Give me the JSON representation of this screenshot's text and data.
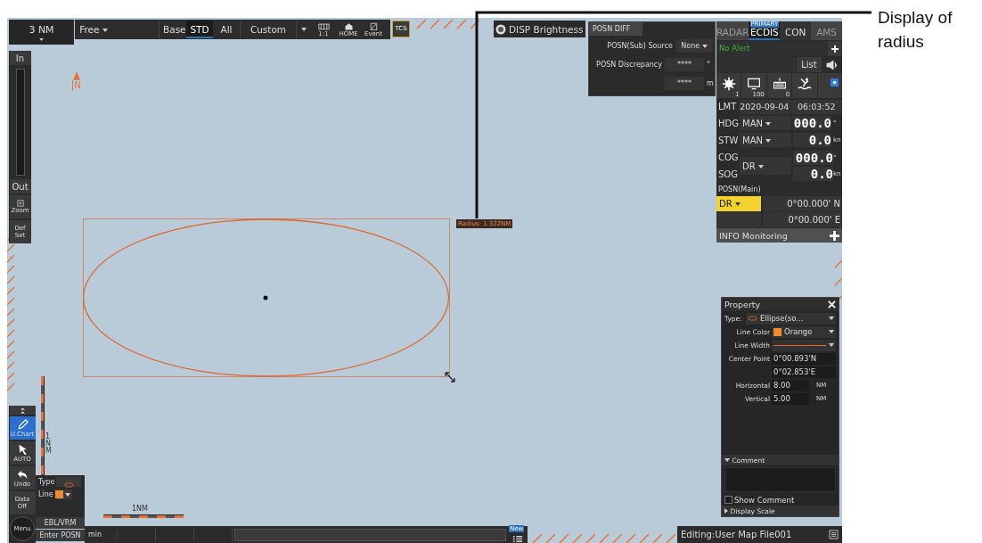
{
  "range_box": {
    "value": "3 NM"
  },
  "toolbar": {
    "orientation": "Free",
    "modes": [
      {
        "label": "Base",
        "selected": false
      },
      {
        "label": "STD",
        "selected": true
      },
      {
        "label": "All",
        "selected": false
      }
    ],
    "custom": "Custom",
    "tools": [
      {
        "kind": "chart",
        "label": "1:1"
      },
      {
        "kind": "home",
        "label": "HOME"
      },
      {
        "kind": "event",
        "label": "Event"
      }
    ],
    "tcs": "TCS"
  },
  "zoom_rail": {
    "zoom_in": "In",
    "zoom_out": "Out",
    "zoom": "Zoom",
    "default_set": "Def Set"
  },
  "north_label": "N",
  "disp_brightness": "DISP Brightness",
  "posn_diff": {
    "title": "POSN DIFF",
    "rows": [
      {
        "kind": "dropdown",
        "label": "POSN(Sub) Source",
        "value": "None"
      },
      {
        "kind": "readout",
        "label": "POSN Discrepancy",
        "value": "****",
        "unit": "°"
      },
      {
        "kind": "readout",
        "value": "****",
        "unit": "m"
      }
    ]
  },
  "mode_tabs": [
    {
      "label": "RADAR",
      "selected": false,
      "disabled": true
    },
    {
      "label": "ECDIS",
      "selected": true,
      "disabled": false,
      "badge": "PRIMARY"
    },
    {
      "label": "CON",
      "selected": false,
      "disabled": false
    },
    {
      "label": "AMS",
      "selected": false,
      "disabled": true
    }
  ],
  "alert": "No Alert",
  "list_button": "List",
  "status_icons": [
    {
      "kind": "brightness",
      "value": "1"
    },
    {
      "kind": "monitor",
      "value": "100"
    },
    {
      "kind": "keyboard",
      "value": "0"
    },
    {
      "kind": "man-overboard"
    },
    {
      "kind": "toggle"
    }
  ],
  "lmt": {
    "label": "LMT",
    "date": "2020-09-04",
    "time": "06:03:52"
  },
  "sensors": [
    {
      "label": "HDG",
      "source": "MAN",
      "value": "000.0",
      "unit": "°"
    },
    {
      "label": "STW",
      "source": "MAN",
      "value": "0.0",
      "unit": "kn"
    }
  ],
  "cog_sog": {
    "cog_label": "COG",
    "sog_label": "SOG",
    "source": "DR",
    "cog": "000.0",
    "cog_unit": "°",
    "sog": "0.0",
    "sog_unit": "kn"
  },
  "posn_main": {
    "title": "POSN(Main)",
    "source": "DR",
    "lat": "0°00.000' N",
    "lon": "0°00.000' E"
  },
  "info_monitoring": "INFO Monitoring",
  "chart": {
    "radius_label": "Radius: 1.322NM",
    "scale_vertical": "1NM",
    "scale_horizontal": "1NM"
  },
  "property": {
    "title": "Property",
    "type_label": "Type:",
    "type_value": "Ellipse(so...",
    "line_color_label": "Line Color",
    "line_color": "Orange",
    "line_width_label": "Line Width",
    "center_label": "Center Point",
    "center_lat": "0°00.893'N",
    "center_lon": "0°02.853'E",
    "dims": [
      {
        "label": "Horizontal",
        "value": "8.00",
        "unit": "NM"
      },
      {
        "label": "Vertical",
        "value": "5.00",
        "unit": "NM"
      }
    ],
    "comment_header": "Comment",
    "show_comment": {
      "label": "Show Comment",
      "checked": false
    },
    "display_scale": "Display Scale"
  },
  "left_tools": [
    {
      "kind": "collapse",
      "selected": false
    },
    {
      "kind": "pencil",
      "label": "U.Chart",
      "selected": true
    },
    {
      "kind": "cursor",
      "label": "AUTO",
      "selected": false
    },
    {
      "kind": "undo",
      "label": "Undo",
      "selected": false
    },
    {
      "kind": "text",
      "label": "Data Off",
      "selected": false
    },
    {
      "kind": "menu",
      "label": "Menu",
      "selected": false
    }
  ],
  "draw_popup": {
    "type_label": "Type",
    "line_label": "Line"
  },
  "bottom_buttons": [
    "EBL/VRM",
    "Enter POSN"
  ],
  "bottom_bar": {
    "unit": "min",
    "badge": "New"
  },
  "status": "Editing:User Map File001",
  "annotation": "Display of radius"
}
